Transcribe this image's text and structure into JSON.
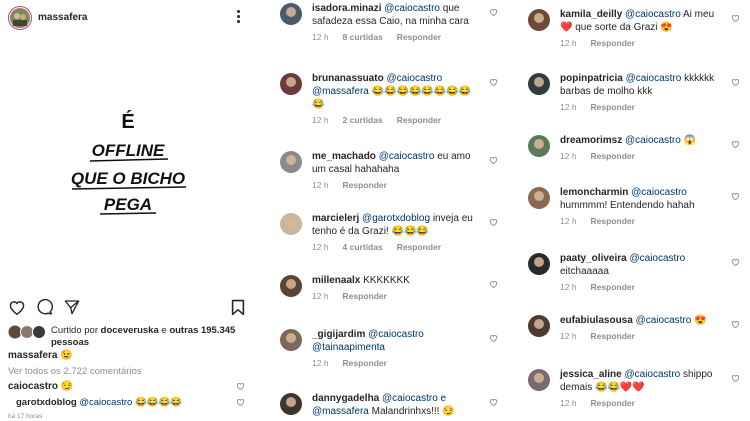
{
  "post": {
    "username": "massafera",
    "image_text": {
      "line1": "É",
      "line2": "OFFLINE",
      "line3": "QUE O BICHO",
      "line4": "PEGA"
    },
    "liked_prefix": "Curtido por",
    "liked_user": "doceveruska",
    "liked_mid": "e",
    "liked_others": "outras 195.345 pessoas",
    "caption_user": "massafera",
    "caption_text": "😉",
    "view_all": "Ver todos os 2.722 comentários",
    "comment1_user": "caiocastro",
    "comment1_text": "😏",
    "comment2_user": "garotxdoblog",
    "comment2_mention": "@caiocastro",
    "comment2_text": "😂😂😂😂",
    "time": "há 17 horas"
  },
  "col2": [
    {
      "user": "isadora.minazi",
      "mention": "@caiocastro",
      "text": "que safadeza essa Caio, na minha cara",
      "time": "12 h",
      "likes": "8 curtidas",
      "reply": "Responder",
      "avatar_color": "#4a5a6a"
    },
    {
      "user": "brunanassuato",
      "mention": "@caiocastro @massafera",
      "text": "😂😂😂😂😂😂😂😂😂",
      "time": "12 h",
      "likes": "2 curtidas",
      "reply": "Responder",
      "avatar_color": "#6b3b3b"
    },
    {
      "user": "me_machado",
      "mention": "@caiocastro",
      "text": "eu amo um casal hahahaha",
      "time": "12 h",
      "likes": "",
      "reply": "Responder",
      "avatar_color": "#8a8a8a"
    },
    {
      "user": "marcielerj",
      "mention": "@garotxdoblog",
      "text": "inveja eu tenho é da Grazi! 😂😂😂",
      "time": "12 h",
      "likes": "4 curtidas",
      "reply": "Responder",
      "avatar_color": "#c8b79c"
    },
    {
      "user": "millenaalx",
      "mention": "",
      "text": "KKKKKKK",
      "time": "12 h",
      "likes": "",
      "reply": "Responder",
      "avatar_color": "#5a4636"
    },
    {
      "user": "_gigijardim",
      "mention": "@caiocastro @tainaapimenta",
      "text": "",
      "time": "12 h",
      "likes": "",
      "reply": "Responder",
      "avatar_color": "#7a6a58"
    },
    {
      "user": "dannygadelha",
      "mention": "@caiocastro e @massafera",
      "text": "Malandrinhxs!!! 😏",
      "time": "12 h",
      "likes": "",
      "reply": "Responder",
      "avatar_color": "#3d3530"
    }
  ],
  "col3": [
    {
      "user": "kamila_deilly",
      "mention": "@caiocastro",
      "text": "Ai meu ❤️ que sorte da Grazi 😍",
      "time": "12 h",
      "likes": "",
      "reply": "Responder",
      "avatar_color": "#6b4a3a"
    },
    {
      "user": "popinpatricia",
      "mention": "@caiocastro",
      "text": "kkkkkk barbas de molho kkk",
      "time": "12 h",
      "likes": "",
      "reply": "Responder",
      "avatar_color": "#333a40"
    },
    {
      "user": "dreamorimsz",
      "mention": "@caiocastro",
      "text": "😱",
      "time": "12 h",
      "likes": "",
      "reply": "Responder",
      "avatar_color": "#5c7a5a"
    },
    {
      "user": "lemoncharmin",
      "mention": "@caiocastro",
      "text": "hummmm! Entendendo hahah",
      "time": "12 h",
      "likes": "",
      "reply": "Responder",
      "avatar_color": "#8a6a50"
    },
    {
      "user": "paaty_oliveira",
      "mention": "@caiocastro",
      "text": "eitchaaaaa",
      "time": "12 h",
      "likes": "",
      "reply": "Responder",
      "avatar_color": "#2a2a2a"
    },
    {
      "user": "eufabiulasousa",
      "mention": "@caiocastro",
      "text": "😍",
      "time": "12 h",
      "likes": "",
      "reply": "Responder",
      "avatar_color": "#4a3a30"
    },
    {
      "user": "jessica_aline",
      "mention": "@caiocastro",
      "text": "shippo demais 😂😂❤️❤️",
      "time": "12 h",
      "likes": "",
      "reply": "Responder",
      "avatar_color": "#7a6a70"
    }
  ]
}
